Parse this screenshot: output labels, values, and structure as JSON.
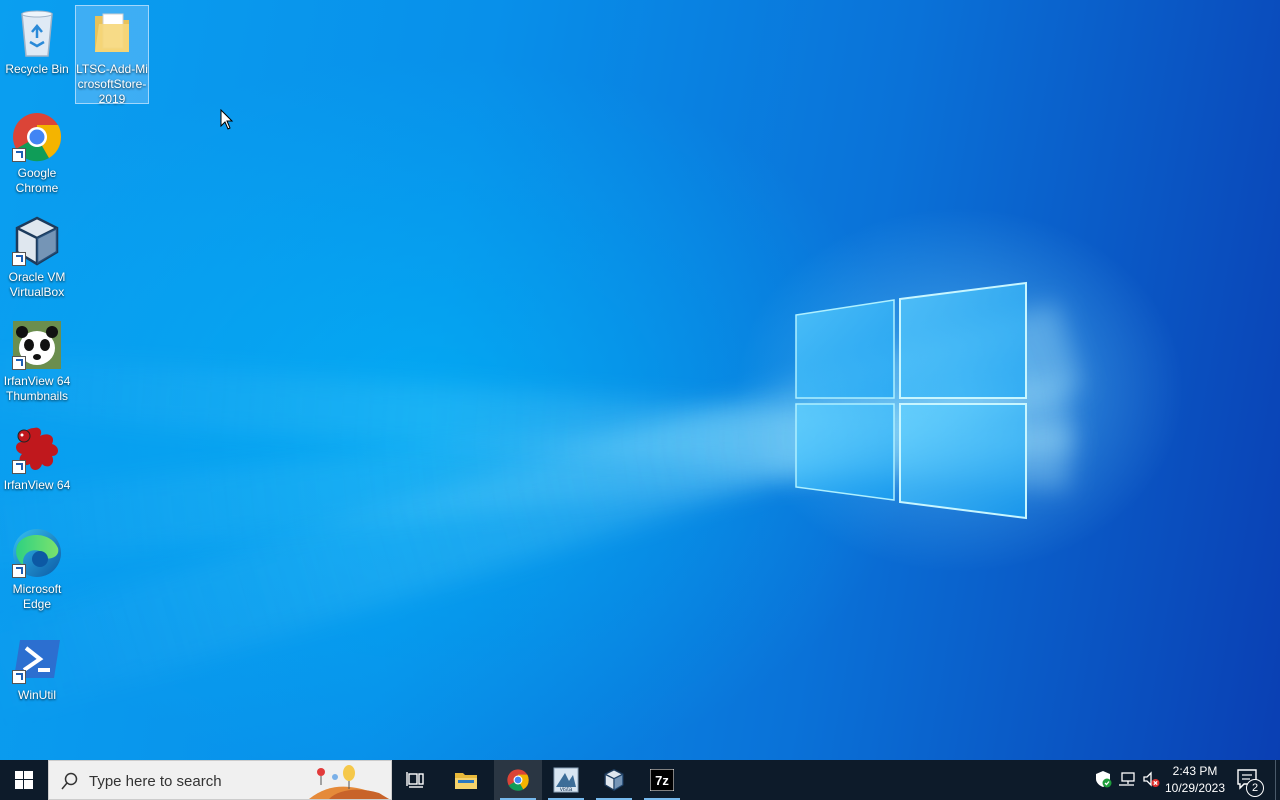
{
  "desktop": {
    "icons": [
      {
        "label": "Recycle Bin",
        "icon": "recycle-bin-icon"
      },
      {
        "label": "LTSC-Add-MicrosoftStore-2019",
        "icon": "folder-icon"
      },
      {
        "label": "Google Chrome",
        "icon": "chrome-icon"
      },
      {
        "label": "Oracle VM VirtualBox",
        "icon": "virtualbox-icon"
      },
      {
        "label": "IrfanView 64 Thumbnails",
        "icon": "irfanview-thumbnails-icon"
      },
      {
        "label": "IrfanView 64",
        "icon": "irfanview-icon"
      },
      {
        "label": "Microsoft Edge",
        "icon": "edge-icon"
      },
      {
        "label": "WinUtil",
        "icon": "powershell-icon"
      }
    ]
  },
  "taskbar": {
    "search_placeholder": "Type here to search",
    "pinned": [
      {
        "name": "Task View",
        "icon": "task-view-icon"
      },
      {
        "name": "File Explorer",
        "icon": "file-explorer-icon"
      },
      {
        "name": "Google Chrome",
        "icon": "chrome-icon",
        "active": true
      },
      {
        "name": "Vista",
        "icon": "vista-app-icon",
        "running": true
      },
      {
        "name": "Oracle VM VirtualBox",
        "icon": "virtualbox-icon",
        "running": true
      },
      {
        "name": "7-Zip",
        "icon": "7zip-icon",
        "running": true
      }
    ],
    "clock": {
      "time": "2:43 PM",
      "date": "10/29/2023"
    },
    "notification_count": "2",
    "vista_label": "vista",
    "sevenzip_label": "7z"
  },
  "colors": {
    "taskbar_bg": "#0d1b2a",
    "desktop_blue": "#0a9ff0",
    "active_indicator": "#76b9ed"
  }
}
